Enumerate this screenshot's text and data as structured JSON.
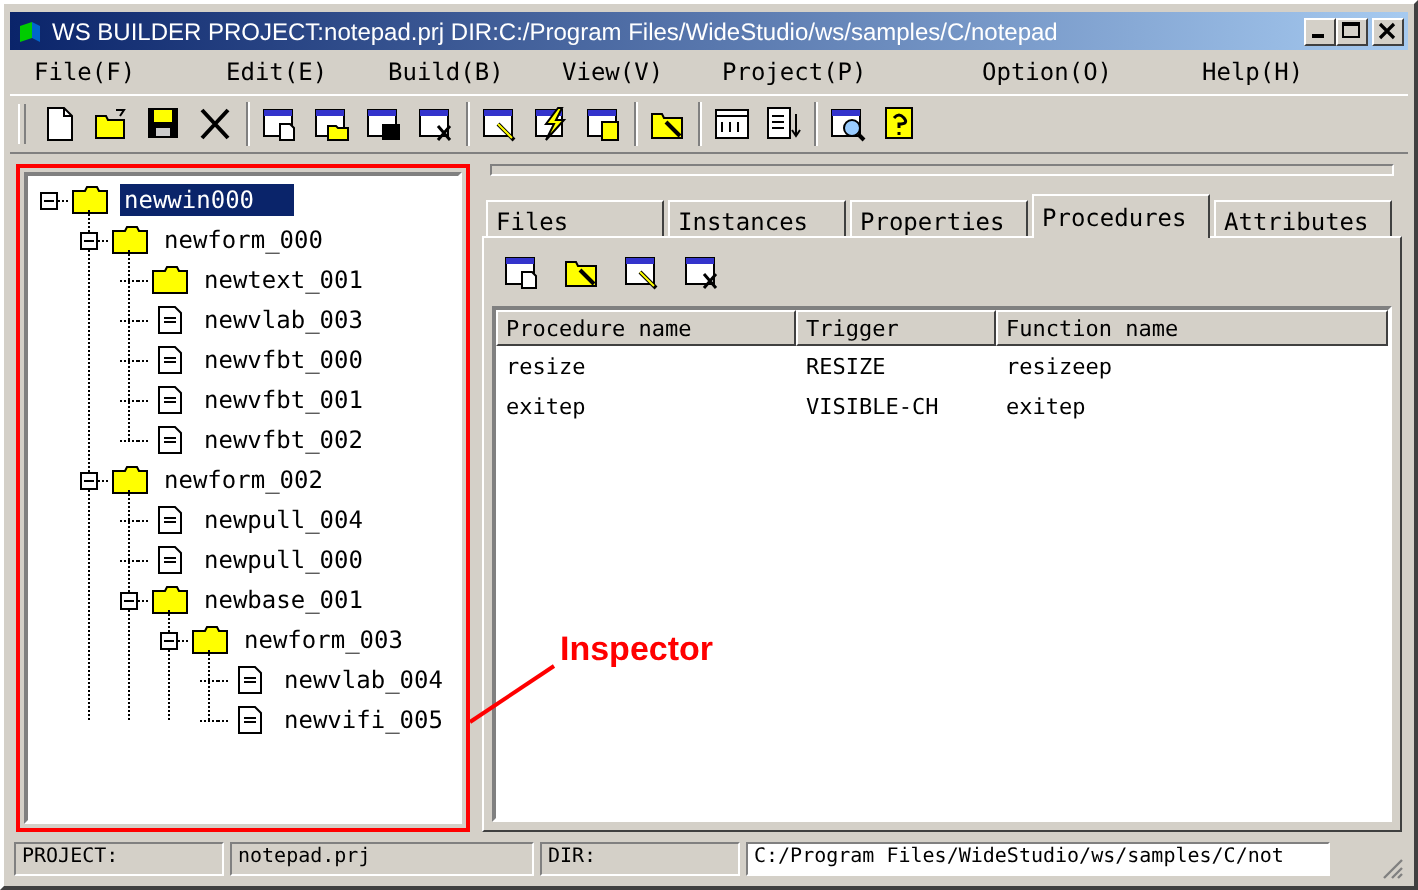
{
  "window": {
    "title": "WS BUILDER PROJECT:notepad.prj DIR:C:/Program Files/WideStudio/ws/samples/C/notepad"
  },
  "menu": [
    "File(F)",
    "Edit(E)",
    "Build(B)",
    "View(V)",
    "Project(P)",
    "Option(O)",
    "Help(H)"
  ],
  "tree": [
    {
      "label": "newwin000",
      "kind": "folder",
      "expanded": true,
      "selected": true,
      "children": [
        {
          "label": "newform_000",
          "kind": "folder",
          "expanded": true,
          "selected": false,
          "children": [
            {
              "label": "newtext_001",
              "kind": "folder",
              "selected": false
            },
            {
              "label": "newvlab_003",
              "kind": "file",
              "selected": false
            },
            {
              "label": "newvfbt_000",
              "kind": "file",
              "selected": false
            },
            {
              "label": "newvfbt_001",
              "kind": "file",
              "selected": false
            },
            {
              "label": "newvfbt_002",
              "kind": "file",
              "selected": false
            }
          ]
        },
        {
          "label": "newform_002",
          "kind": "folder",
          "expanded": true,
          "selected": false,
          "children": [
            {
              "label": "newpull_004",
              "kind": "file",
              "selected": false
            },
            {
              "label": "newpull_000",
              "kind": "file",
              "selected": false
            },
            {
              "label": "newbase_001",
              "kind": "folder",
              "expanded": true,
              "selected": false,
              "children": [
                {
                  "label": "newform_003",
                  "kind": "folder",
                  "expanded": true,
                  "selected": false,
                  "children": [
                    {
                      "label": "newvlab_004",
                      "kind": "file",
                      "selected": false
                    },
                    {
                      "label": "newvifi_005",
                      "kind": "file",
                      "selected": false
                    }
                  ]
                }
              ]
            }
          ]
        }
      ]
    }
  ],
  "tabs": [
    {
      "label": "Files",
      "selected": false
    },
    {
      "label": "Instances",
      "selected": false
    },
    {
      "label": "Properties",
      "selected": false
    },
    {
      "label": "Procedures",
      "selected": true
    },
    {
      "label": "Attributes",
      "selected": false
    }
  ],
  "table": {
    "columns": [
      "Procedure name",
      "Trigger",
      "Function name"
    ],
    "rows": [
      [
        "resize",
        "RESIZE",
        "resizeep"
      ],
      [
        "exitep",
        "VISIBLE-CH",
        "exitep"
      ]
    ]
  },
  "annotation": {
    "label": "Inspector"
  },
  "status_bar": [
    "PROJECT:",
    "notepad.prj",
    "DIR:",
    "C:/Program Files/WideStudio/ws/samples/C/not"
  ]
}
